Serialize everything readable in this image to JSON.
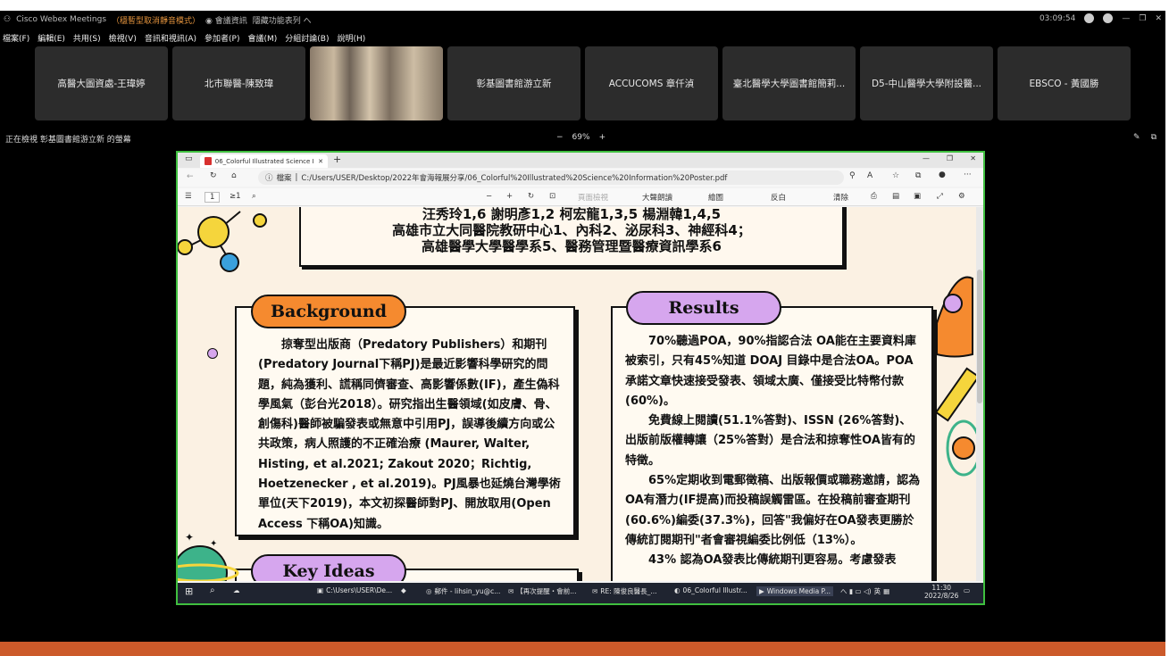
{
  "webex": {
    "app_title": "Cisco Webex Meetings",
    "mode": "（穩暫型取消靜音模式）",
    "meeting_info": "會議資訊",
    "hide_menu": "隱藏功能表列 へ",
    "time": "03:09:54",
    "menus": [
      "檔案(F)",
      "編輯(E)",
      "共用(S)",
      "檢視(V)",
      "音訊和視訊(A)",
      "參加者(P)",
      "會議(M)",
      "分組討論(B)",
      "說明(H)"
    ],
    "participants": [
      "高醫大圖資處-王瑋婷",
      "北市聯醫-陳致瑋",
      "",
      "彰基圖書館游立新",
      "ACCUCOMS 章仟湞",
      "臺北醫學大學圖書館簡莉...",
      "D5-中山醫學大學附設醫...",
      "EBSCO - 黃國勝"
    ],
    "viewing": "正在檢視 彰基圖書館游立新 的螢幕",
    "zoom": "69%",
    "zoom_minus": "−",
    "zoom_plus": "+"
  },
  "browser": {
    "tab_title": "06_Colorful Illustrated Science In",
    "file_label": "檔案",
    "url": "C:/Users/USER/Desktop/2022年會海報展分享/06_Colorful%20Illustrated%20Science%20Information%20Poster.pdf",
    "page": "1",
    "page_total": "≥1",
    "toolbar": {
      "minus": "−",
      "plus": "+",
      "page_view": "頁面檢視",
      "read_aloud": "大聲朗讀",
      "draw": "繪圖",
      "highlight": "反白",
      "erase": "清除"
    }
  },
  "poster": {
    "authors_line1": "汪秀玲1,6 謝明彥1,2 柯宏龍1,3,5 楊淵韓1,4,5",
    "authors_line2": "高雄市立大同醫院教研中心1、內科2、泌尿科3、神經科4；",
    "authors_line3": "高雄醫學大學醫學系5、醫務管理暨醫療資訊學系6",
    "background_title": "Background",
    "background_text": "　　掠奪型出版商（Predatory Publishers）和期刊(Predatory Journal下稱PJ)是最近影響科學研究的問題，純為獲利、謊稱同儕審查、高影響係數(IF)，產生偽科學風氣（彭台光2018）。研究指出生醫領域(如皮膚、骨、創傷科)醫師被騙發表或無意中引用PJ，誤導後續方向或公共政策，病人照護的不正確治療 (Maurer, Walter, Histing, et al.2021; Zakout 2020；Richtig, Hoetzenecker , et al.2019)。PJ風暴也延燒台灣學術單位(天下2019)，本文初探醫師對PJ、開放取用(Open Access 下稱OA)知識。",
    "results_title": "Results",
    "results_p1": "　　70%聽過POA，90%指認合法 OA能在主要資料庫被索引，只有45%知道 DOAJ 目錄中是合法OA。POA承諾文章快速接受發表、領域太廣、僅接受比特幣付款(60%)。",
    "results_p2": "　　免費線上閱讀(51.1%答對)、ISSN (26%答對)、出版前版權轉讓（25%答對）是合法和掠奪性OA皆有的特徵。",
    "results_p3": "　　65%定期收到電郵徵稿、出版報價或職務邀請，認為OA有潛力(IF提高)而投稿誤觸雷區。在投稿前審查期刊(60.6%)編委(37.3%)，回答\"我偏好在OA發表更勝於傳統訂閱期刊\"者會審視編委比例低（13%）。",
    "results_p4": "　　43% 認為OA發表比傳統期刊更容易。考慮發表",
    "keyideas_title": "Key Ideas"
  },
  "taskbar": {
    "items": [
      "C:\\Users\\USER\\De...",
      "郵件 - lihsin_yu@c...",
      "【再次提醒・會前...",
      "RE: 陳俊良醫長_...",
      "06_Colorful Illustr...",
      "Windows Media P..."
    ],
    "lang": "英",
    "time": "11:30",
    "date": "2022/8/26"
  },
  "colors": {
    "accent_orange": "#f58a2f",
    "accent_purple": "#d6a6ee",
    "share_border": "#3fbf3f"
  }
}
